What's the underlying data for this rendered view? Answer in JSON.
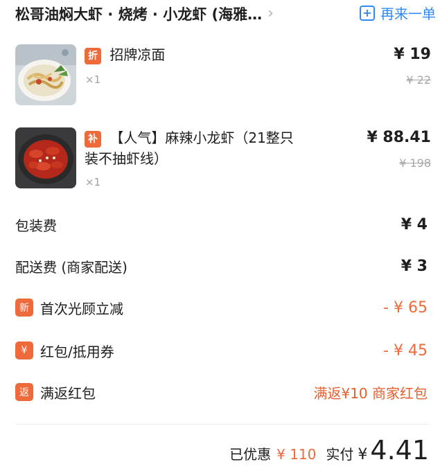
{
  "header": {
    "shop_name": "松哥油焖大虾 · 烧烤 · 小龙虾 (海雅…",
    "chevron": "›",
    "reorder_label": "再来一单",
    "reorder_icon": "plus-square-icon"
  },
  "items": [
    {
      "tag": "折",
      "name": "招牌凉面",
      "qty": "×1",
      "price": "¥ 19",
      "orig_price": "¥ 22",
      "image": "cold-noodles-photo"
    },
    {
      "tag": "补",
      "name_line1": "【人气】麻辣小龙虾（21整只",
      "name_line2": "装不抽虾线）",
      "qty": "×1",
      "price": "¥ 88.41",
      "orig_price": "¥ 198",
      "image": "crayfish-photo"
    }
  ],
  "fees": {
    "packing_label": "包装费",
    "packing_value": "¥ 4",
    "delivery_label": "配送费 (商家配送)",
    "delivery_value": "¥ 3"
  },
  "discounts": {
    "first_icon": "新",
    "first_label": "首次光顾立减",
    "first_value": "- ¥ 65",
    "coupon_icon": "¥",
    "coupon_label": "红包/抵用券",
    "coupon_value": "- ¥ 45",
    "rebate_icon": "返",
    "rebate_label": "满返红包",
    "rebate_value": "满返¥10 商家红包"
  },
  "summary": {
    "saved_label": "已优惠",
    "saved_value": "¥ 110",
    "paid_label": "实付",
    "currency": "¥",
    "paid_value": "4.41"
  },
  "colors": {
    "accent": "#ee6a3a",
    "link": "#2f8af5"
  }
}
